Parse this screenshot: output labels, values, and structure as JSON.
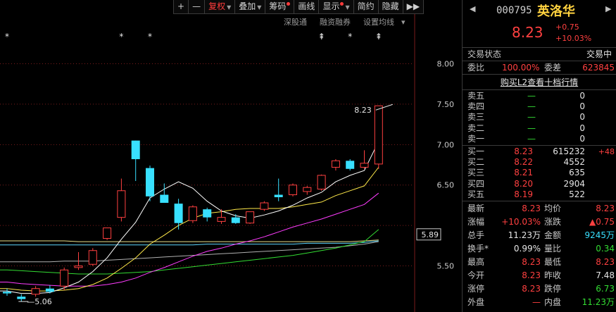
{
  "toolbar": {
    "items": [
      {
        "label": "+",
        "caret": false,
        "dot": false,
        "active": false
      },
      {
        "label": "—",
        "caret": false,
        "dot": false,
        "active": false
      },
      {
        "label": "复权",
        "caret": true,
        "dot": false,
        "active": true
      },
      {
        "label": "叠加",
        "caret": true,
        "dot": false,
        "active": false
      },
      {
        "label": "筹码",
        "caret": false,
        "dot": true,
        "active": false
      },
      {
        "label": "画线",
        "caret": false,
        "dot": false,
        "active": false
      },
      {
        "label": "显示",
        "caret": true,
        "dot": true,
        "active": false
      },
      {
        "label": "简约",
        "caret": false,
        "dot": false,
        "active": false
      },
      {
        "label": "隐藏",
        "caret": false,
        "dot": false,
        "active": false
      },
      {
        "label": "▶▶",
        "caret": false,
        "dot": false,
        "active": false
      }
    ]
  },
  "subtoolbar": {
    "items": [
      "深股通",
      "融资融券",
      "设置均线"
    ]
  },
  "colors": {
    "up": "#ff4040",
    "down": "#38e0ff",
    "ma5": "#ffffff",
    "ma10": "#ffe94a",
    "ma20": "#ff3cff",
    "ma60": "#33dd33",
    "ma_flat1": "#e8e08a",
    "ma_flat2": "#5fd8ff",
    "ma_flat3": "#b0b0b0"
  },
  "chart_data": {
    "type": "candlestick",
    "y_axis_ticks": [
      8.0,
      7.5,
      7.0,
      6.5,
      5.5
    ],
    "current_price_tag": "5.89",
    "high_label": "8.23",
    "low_label": "5.06",
    "ylim": [
      4.93,
      8.44
    ],
    "grid": true,
    "ohlc": [
      {
        "o": 5.18,
        "h": 5.22,
        "l": 5.13,
        "c": 5.16
      },
      {
        "o": 5.12,
        "h": 5.15,
        "l": 5.06,
        "c": 5.09
      },
      {
        "o": 5.15,
        "h": 5.25,
        "l": 5.12,
        "c": 5.22
      },
      {
        "o": 5.22,
        "h": 5.26,
        "l": 5.16,
        "c": 5.18
      },
      {
        "o": 5.25,
        "h": 5.48,
        "l": 5.2,
        "c": 5.45
      },
      {
        "o": 5.48,
        "h": 5.67,
        "l": 5.45,
        "c": 5.5
      },
      {
        "o": 5.52,
        "h": 5.72,
        "l": 5.5,
        "c": 5.69
      },
      {
        "o": 5.84,
        "h": 5.97,
        "l": 5.82,
        "c": 5.97
      },
      {
        "o": 6.1,
        "h": 6.58,
        "l": 6.05,
        "c": 6.43
      },
      {
        "o": 7.05,
        "h": 7.05,
        "l": 6.55,
        "c": 6.82
      },
      {
        "o": 6.71,
        "h": 6.74,
        "l": 6.3,
        "c": 6.36
      },
      {
        "o": 6.38,
        "h": 6.52,
        "l": 6.28,
        "c": 6.28
      },
      {
        "o": 6.27,
        "h": 6.33,
        "l": 5.95,
        "c": 6.03
      },
      {
        "o": 6.06,
        "h": 6.25,
        "l": 6.03,
        "c": 6.23
      },
      {
        "o": 6.2,
        "h": 6.22,
        "l": 6.05,
        "c": 6.1
      },
      {
        "o": 6.05,
        "h": 6.2,
        "l": 6.02,
        "c": 6.1
      },
      {
        "o": 6.1,
        "h": 6.14,
        "l": 6.02,
        "c": 6.03
      },
      {
        "o": 6.03,
        "h": 6.17,
        "l": 6.02,
        "c": 6.17
      },
      {
        "o": 6.2,
        "h": 6.3,
        "l": 6.18,
        "c": 6.28
      },
      {
        "o": 6.38,
        "h": 6.58,
        "l": 6.3,
        "c": 6.35
      },
      {
        "o": 6.38,
        "h": 6.52,
        "l": 6.36,
        "c": 6.5
      },
      {
        "o": 6.42,
        "h": 6.49,
        "l": 6.38,
        "c": 6.47
      },
      {
        "o": 6.45,
        "h": 6.63,
        "l": 6.43,
        "c": 6.62
      },
      {
        "o": 6.72,
        "h": 6.82,
        "l": 6.68,
        "c": 6.8
      },
      {
        "o": 6.8,
        "h": 6.82,
        "l": 6.68,
        "c": 6.7
      },
      {
        "o": 6.72,
        "h": 6.93,
        "l": 6.7,
        "c": 6.77
      },
      {
        "o": 6.76,
        "h": 7.48,
        "l": 6.7,
        "c": 7.48
      }
    ],
    "ma": {
      "ma5": [
        5.19,
        5.16,
        5.16,
        5.17,
        5.23,
        5.3,
        5.43,
        5.6,
        5.83,
        6.04,
        6.34,
        6.45,
        6.54,
        6.46,
        6.3,
        6.18,
        6.12,
        6.09,
        6.13,
        6.18,
        6.25,
        6.34,
        6.41,
        6.54,
        6.62,
        6.68,
        7.04
      ],
      "ma10": [
        5.22,
        5.2,
        5.19,
        5.19,
        5.2,
        5.22,
        5.27,
        5.35,
        5.47,
        5.6,
        5.77,
        5.88,
        6.0,
        6.09,
        6.15,
        6.17,
        6.2,
        6.21,
        6.21,
        6.21,
        6.23,
        6.26,
        6.29,
        6.37,
        6.43,
        6.49,
        6.72
      ],
      "ma20": [
        5.3,
        5.28,
        5.27,
        5.26,
        5.25,
        5.25,
        5.25,
        5.27,
        5.3,
        5.35,
        5.42,
        5.48,
        5.55,
        5.62,
        5.68,
        5.72,
        5.77,
        5.81,
        5.86,
        5.92,
        5.98,
        6.03,
        6.08,
        6.14,
        6.2,
        6.26,
        6.4
      ],
      "ma60": [
        5.45,
        5.44,
        5.43,
        5.42,
        5.41,
        5.4,
        5.4,
        5.4,
        5.41,
        5.42,
        5.43,
        5.45,
        5.47,
        5.49,
        5.51,
        5.53,
        5.55,
        5.57,
        5.59,
        5.61,
        5.63,
        5.66,
        5.69,
        5.72,
        5.76,
        5.8,
        5.95
      ],
      "ma_flat1": [
        5.81,
        5.81,
        5.81,
        5.81,
        5.81,
        5.8,
        5.8,
        5.8,
        5.8,
        5.8,
        5.8,
        5.8,
        5.8,
        5.8,
        5.8,
        5.8,
        5.8,
        5.8,
        5.8,
        5.8,
        5.8,
        5.8,
        5.8,
        5.8,
        5.8,
        5.81,
        5.82
      ],
      "ma_flat2": [
        5.76,
        5.76,
        5.76,
        5.76,
        5.76,
        5.76,
        5.76,
        5.76,
        5.76,
        5.76,
        5.76,
        5.76,
        5.76,
        5.76,
        5.77,
        5.77,
        5.77,
        5.77,
        5.77,
        5.77,
        5.77,
        5.78,
        5.78,
        5.78,
        5.78,
        5.79,
        5.81
      ],
      "ma_flat3": [
        5.55,
        5.55,
        5.55,
        5.55,
        5.56,
        5.56,
        5.56,
        5.57,
        5.58,
        5.59,
        5.6,
        5.61,
        5.62,
        5.63,
        5.64,
        5.65,
        5.66,
        5.67,
        5.68,
        5.69,
        5.7,
        5.71,
        5.72,
        5.73,
        5.75,
        5.77,
        5.8
      ]
    },
    "event_markers": [
      {
        "index": 0,
        "symbol": "*"
      },
      {
        "index": 8,
        "symbol": "*"
      },
      {
        "index": 10,
        "symbol": "*"
      },
      {
        "index": 22,
        "symbol": "⇞"
      },
      {
        "index": 24,
        "symbol": "*"
      },
      {
        "index": 26,
        "symbol": "⇞"
      }
    ]
  },
  "stock": {
    "code": "000795",
    "name": "英洛华",
    "price": "8.23",
    "change": "+0.75",
    "change_pct": "+10.03%"
  },
  "status": {
    "label": "交易状态",
    "value": "交易中"
  },
  "ratio": {
    "wb_label": "委比",
    "wb_value": "100.00%",
    "wc_label": "委差",
    "wc_value": "623845"
  },
  "l2_link": "购买L2查看十档行情",
  "asks": [
    {
      "label": "卖五",
      "price": "—",
      "vol": "0"
    },
    {
      "label": "卖四",
      "price": "—",
      "vol": "0"
    },
    {
      "label": "卖三",
      "price": "—",
      "vol": "0"
    },
    {
      "label": "卖二",
      "price": "—",
      "vol": "0"
    },
    {
      "label": "卖一",
      "price": "—",
      "vol": "0"
    }
  ],
  "bids": [
    {
      "label": "买一",
      "price": "8.23",
      "vol": "615232",
      "chg": "+48"
    },
    {
      "label": "买二",
      "price": "8.22",
      "vol": "4552",
      "chg": ""
    },
    {
      "label": "买三",
      "price": "8.21",
      "vol": "635",
      "chg": ""
    },
    {
      "label": "买四",
      "price": "8.20",
      "vol": "2904",
      "chg": ""
    },
    {
      "label": "买五",
      "price": "8.19",
      "vol": "522",
      "chg": ""
    }
  ],
  "stats": [
    {
      "l1": "最新",
      "v1": "8.23",
      "c1": "red",
      "l2": "均价",
      "v2": "8.23",
      "c2": "red"
    },
    {
      "l1": "涨幅",
      "v1": "+10.03%",
      "c1": "red",
      "l2": "涨跌",
      "v2": "▲0.75",
      "c2": "red"
    },
    {
      "l1": "总手",
      "v1": "11.23万",
      "c1": "white",
      "l2": "金额",
      "v2": "9245万",
      "c2": "cyan"
    },
    {
      "l1": "换手*",
      "v1": "0.99%",
      "c1": "white",
      "l2": "量比",
      "v2": "0.34",
      "c2": "green"
    },
    {
      "l1": "最高",
      "v1": "8.23",
      "c1": "red",
      "l2": "最低",
      "v2": "8.23",
      "c2": "red"
    },
    {
      "l1": "今开",
      "v1": "8.23",
      "c1": "red",
      "l2": "昨收",
      "v2": "7.48",
      "c2": "white"
    },
    {
      "l1": "涨停",
      "v1": "8.23",
      "c1": "red",
      "l2": "跌停",
      "v2": "6.73",
      "c2": "green"
    },
    {
      "l1": "外盘",
      "v1": "—",
      "c1": "red",
      "l2": "内盘",
      "v2": "11.23万",
      "c2": "green"
    }
  ]
}
